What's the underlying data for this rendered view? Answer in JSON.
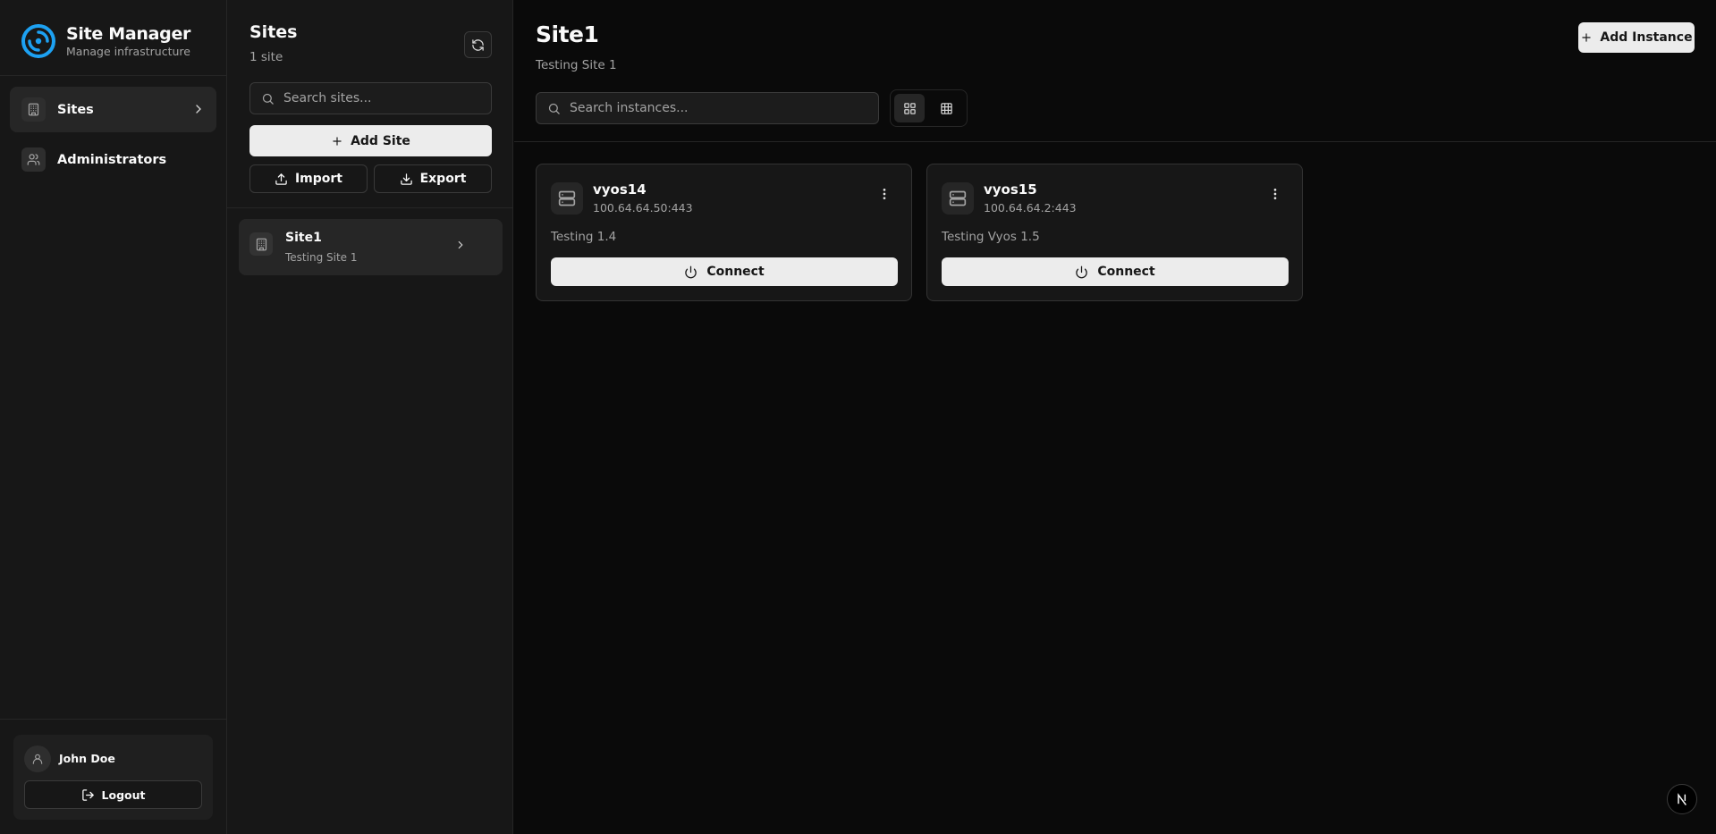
{
  "brand": {
    "title": "Site Manager",
    "subtitle": "Manage infrastructure",
    "logo_icon": "swirl-logo-icon",
    "accent_color": "#1da1f2"
  },
  "nav": {
    "items": [
      {
        "label": "Sites",
        "icon": "building-icon",
        "active": true
      },
      {
        "label": "Administrators",
        "icon": "users-icon",
        "active": false
      }
    ]
  },
  "user": {
    "name": "John Doe",
    "logout_label": "Logout"
  },
  "sites_panel": {
    "title": "Sites",
    "count": "1 site",
    "search_placeholder": "Search sites...",
    "add_site_label": "Add Site",
    "import_label": "Import",
    "export_label": "Export",
    "items": [
      {
        "name": "Site1",
        "description": "Testing Site 1",
        "selected": true
      }
    ]
  },
  "main": {
    "title": "Site1",
    "subtitle": "Testing Site 1",
    "add_instance_label": "Add Instance",
    "search_placeholder": "Search instances...",
    "view_mode": "grid",
    "instances": [
      {
        "name": "vyos14",
        "address": "100.64.64.50:443",
        "description": "Testing 1.4",
        "connect_label": "Connect"
      },
      {
        "name": "vyos15",
        "address": "100.64.64.2:443",
        "description": "Testing Vyos 1.5",
        "connect_label": "Connect"
      }
    ]
  }
}
